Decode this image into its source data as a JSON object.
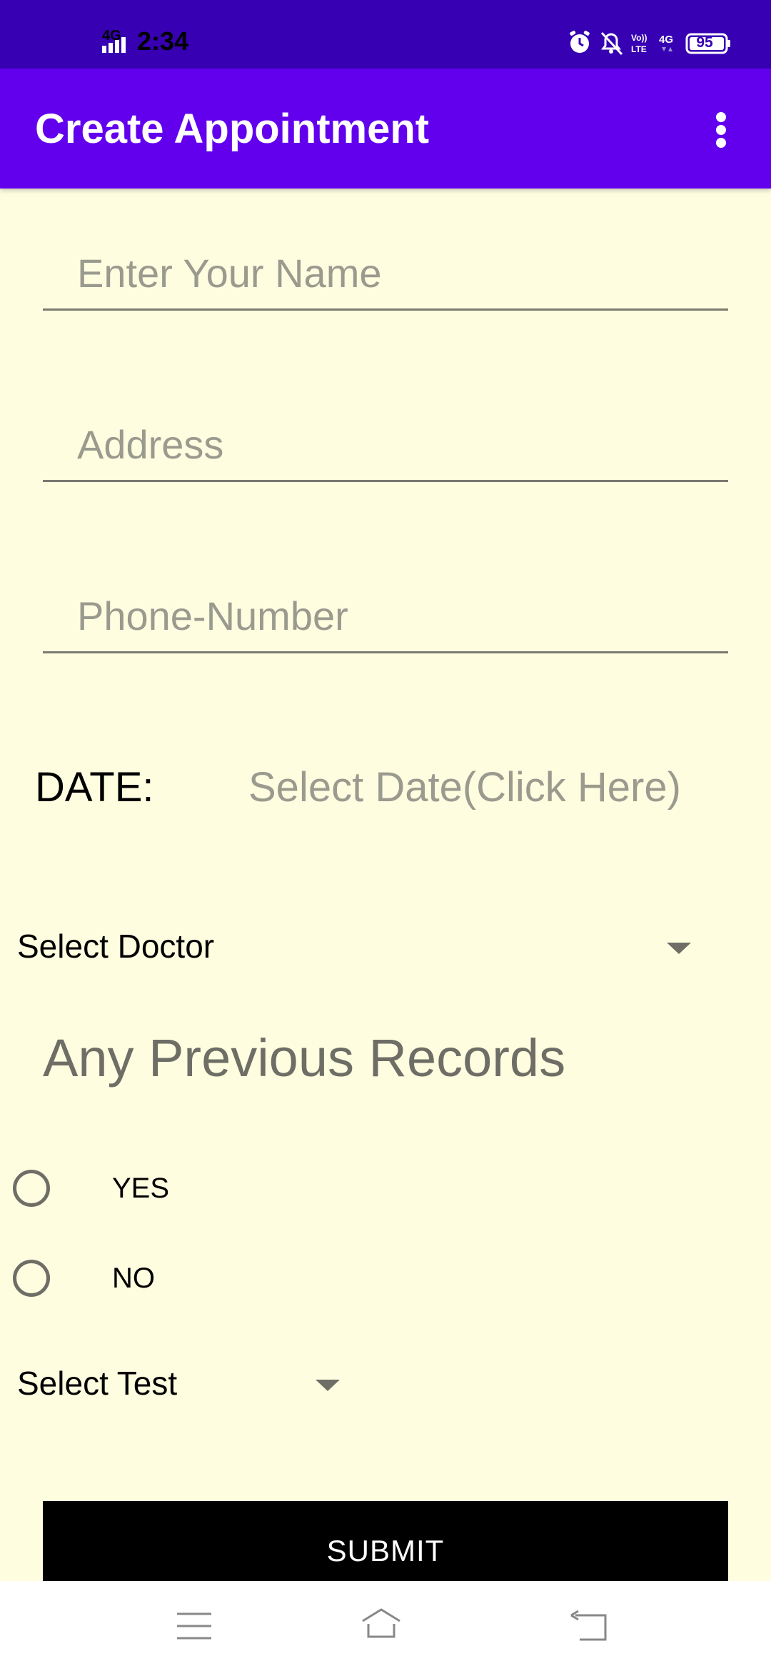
{
  "status_bar": {
    "network": "4G",
    "time": "2:34",
    "battery": "95",
    "icons": [
      "signal-icon",
      "alarm-icon",
      "notifications-off-icon",
      "volte-icon",
      "4g-icon",
      "battery-icon"
    ]
  },
  "app_bar": {
    "title": "Create Appointment",
    "overflow_icon": "more-vert-icon"
  },
  "form": {
    "name_placeholder": "Enter Your Name",
    "name_value": "",
    "address_placeholder": "Address",
    "address_value": "",
    "phone_placeholder": "Phone-Number",
    "phone_value": "",
    "date_label": "DATE:",
    "date_value": "Select Date(Click Here)",
    "doctor_select": "Select Doctor",
    "records_heading": "Any Previous Records",
    "radio_yes": "YES",
    "radio_no": "NO",
    "test_select": "Select Test",
    "submit_label": "SUBMIT"
  },
  "nav_bar": {
    "icons": [
      "menu-icon",
      "home-icon",
      "back-icon"
    ]
  },
  "colors": {
    "status_bar": "#3700B3",
    "app_bar": "#6200EE",
    "background": "#FFFDE0",
    "hint": "#9A9A8E",
    "button": "#000000"
  }
}
